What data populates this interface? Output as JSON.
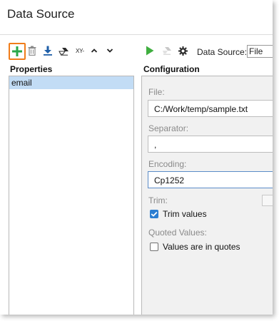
{
  "window": {
    "title": "Data Source"
  },
  "toolbar": {
    "icons": [
      "add-icon",
      "trash-icon",
      "download-icon",
      "eraser-icon",
      "xy-icon",
      "chevron-up-icon",
      "chevron-down-icon",
      "play-icon",
      "clear-icon",
      "gear-icon"
    ],
    "xy_label": "XY-",
    "data_source_label": "Data Source:",
    "data_source_value": "File"
  },
  "properties": {
    "title": "Properties",
    "items": [
      "email"
    ]
  },
  "configuration": {
    "title": "Configuration",
    "file_label": "File:",
    "file_value": "C:/Work/temp/sample.txt",
    "separator_label": "Separator:",
    "separator_value": ",",
    "encoding_label": "Encoding:",
    "encoding_value": "Cp1252",
    "trim_label": "Trim:",
    "trim_values_label": "Trim values",
    "trim_values_checked": true,
    "quoted_label": "Quoted Values:",
    "quotes_label": "Values are in quotes",
    "quotes_checked": false
  },
  "colors": {
    "highlight": "#f07d1a",
    "add_green": "#2aa84a",
    "run_green": "#3fae3f",
    "selection": "#c2dcf5",
    "check_blue": "#2c7ed1"
  }
}
